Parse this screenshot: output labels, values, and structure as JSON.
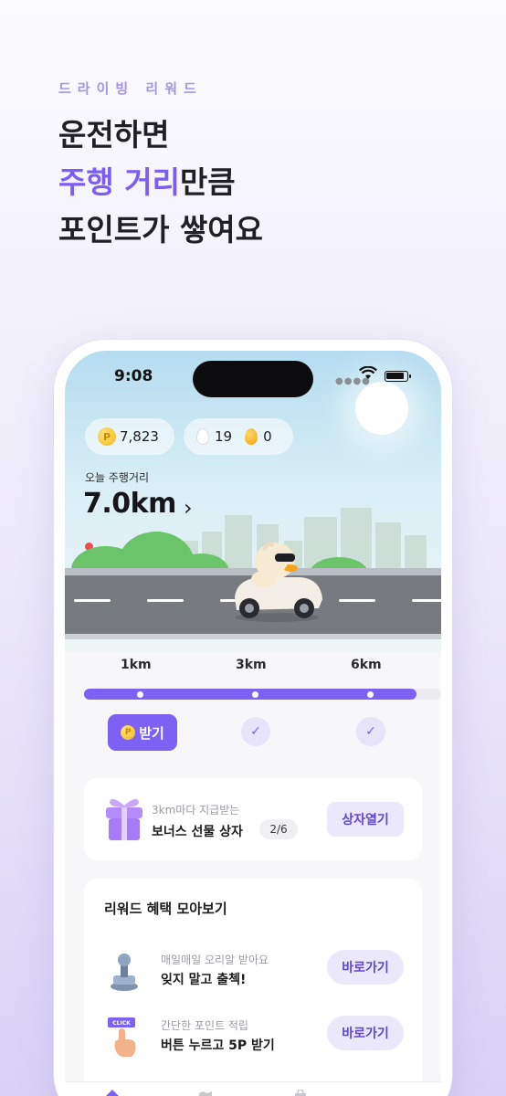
{
  "hero": {
    "eyebrow": "드라이빙 리워드",
    "line1": "운전하면",
    "line2_accent": "주행 거리",
    "line2_rest": "만큼",
    "line3": "포인트가 쌓여요"
  },
  "status_bar": {
    "time": "9:08"
  },
  "wallet": {
    "points": "7,823",
    "white_eggs": "19",
    "golden_eggs": "0"
  },
  "driving": {
    "label": "오늘 주행거리",
    "distance": "7.0km"
  },
  "milestones": {
    "labels": [
      "1km",
      "3km",
      "6km"
    ],
    "progress_fraction": 0.93,
    "claim_label": "받기"
  },
  "bonus_box": {
    "subtitle": "3km마다 지급받는",
    "title": "보너스 선물 상자",
    "count": "2/6",
    "button_label": "상자열기"
  },
  "benefits": {
    "title": "리워드 혜택 모아보기",
    "items": [
      {
        "subtitle": "매일매일 오리알 받아요",
        "title": "잊지 말고 출첵!",
        "button_label": "바로가기",
        "icon": "stamp-icon"
      },
      {
        "subtitle": "간단한 포인트 적립",
        "title": "버튼 누르고 5P 받기",
        "button_label": "바로가기",
        "icon": "click-hand-icon"
      }
    ]
  },
  "icon_badges": {
    "click": "CLICK"
  },
  "colors": {
    "accent": "#7d61f3",
    "headline_accent": "#7c5cf5",
    "button_bg": "#ece8fb"
  }
}
